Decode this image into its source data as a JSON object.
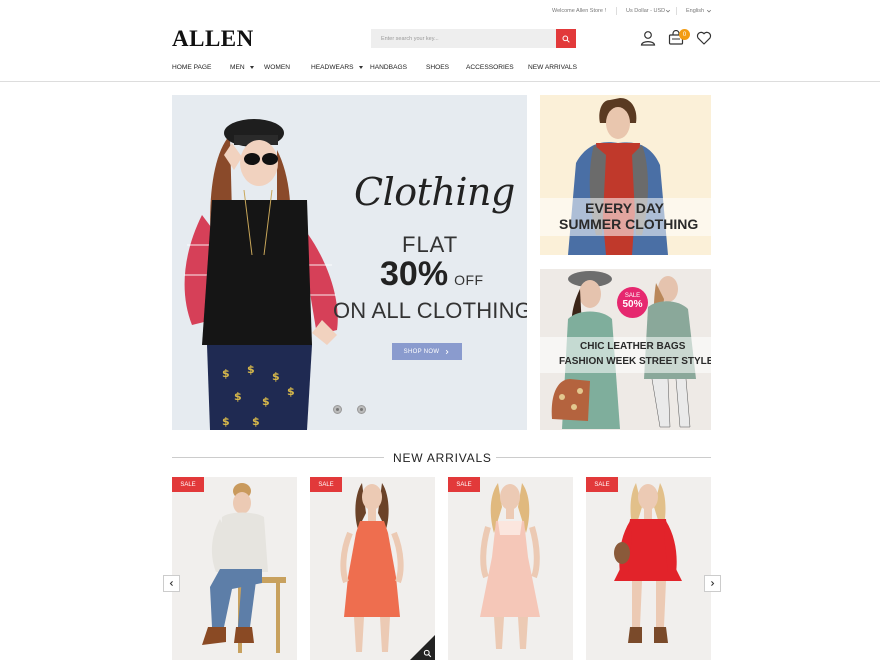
{
  "topbar": {
    "welcome": "Welcome Allen Store !",
    "currency": "Us Dollar - USD",
    "language": "English"
  },
  "header": {
    "logo": "ALLEN",
    "search_placeholder": "Enter search your key...",
    "cart_count": "0"
  },
  "nav": {
    "items": [
      {
        "label": "HOME PAGE"
      },
      {
        "label": "MEN"
      },
      {
        "label": "WOMEN"
      },
      {
        "label": "HEADWEARS"
      },
      {
        "label": "HANDBAGS"
      },
      {
        "label": "SHOES"
      },
      {
        "label": "ACCESSORIES"
      },
      {
        "label": "NEW ARRIVALS"
      }
    ]
  },
  "hero": {
    "script_title": "Clothing",
    "flat": "FLAT",
    "percent": "30%",
    "off": "OFF",
    "line": "ON ALL CLOTHING",
    "button": "SHOP NOW",
    "button_icon": "chevron-right-icon"
  },
  "banners": {
    "first": {
      "line1": "EVERY DAY",
      "line2": "SUMMER CLOTHING"
    },
    "second": {
      "line1": "CHIC LEATHER BAGS",
      "line2": "FASHION WEEK STREET STYLE",
      "badge_top": "SALE",
      "badge_value": "50%"
    }
  },
  "section": {
    "title": "NEW ARRIVALS"
  },
  "products": [
    {
      "badge": "SALE"
    },
    {
      "badge": "SALE"
    },
    {
      "badge": "SALE"
    },
    {
      "badge": "SALE"
    }
  ],
  "colors": {
    "accent_red": "#e2393a",
    "cart_badge": "#f39c12",
    "shop_button": "#8a9bce",
    "sale_circle": "#e6286f"
  }
}
